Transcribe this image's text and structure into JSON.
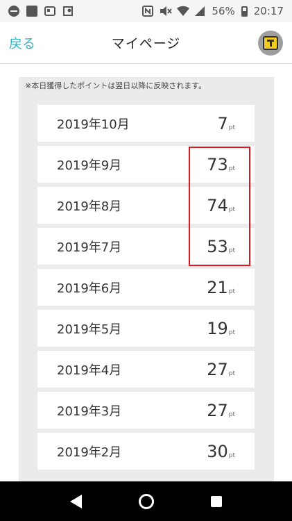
{
  "status_bar": {
    "battery_percent": "56%",
    "time": "20:17"
  },
  "header": {
    "back_label": "戻る",
    "title": "マイページ"
  },
  "notice": "※本日獲得したポイントは翌日以降に反映されます。",
  "points": {
    "unit": "pt",
    "rows": [
      {
        "month": "2019年10月",
        "value": "7"
      },
      {
        "month": "2019年9月",
        "value": "73"
      },
      {
        "month": "2019年8月",
        "value": "74"
      },
      {
        "month": "2019年7月",
        "value": "53"
      },
      {
        "month": "2019年6月",
        "value": "21"
      },
      {
        "month": "2019年5月",
        "value": "19"
      },
      {
        "month": "2019年4月",
        "value": "27"
      },
      {
        "month": "2019年3月",
        "value": "27"
      },
      {
        "month": "2019年2月",
        "value": "30"
      }
    ]
  },
  "colors": {
    "accent": "#35b4c4",
    "highlight_border": "#e0161d"
  }
}
